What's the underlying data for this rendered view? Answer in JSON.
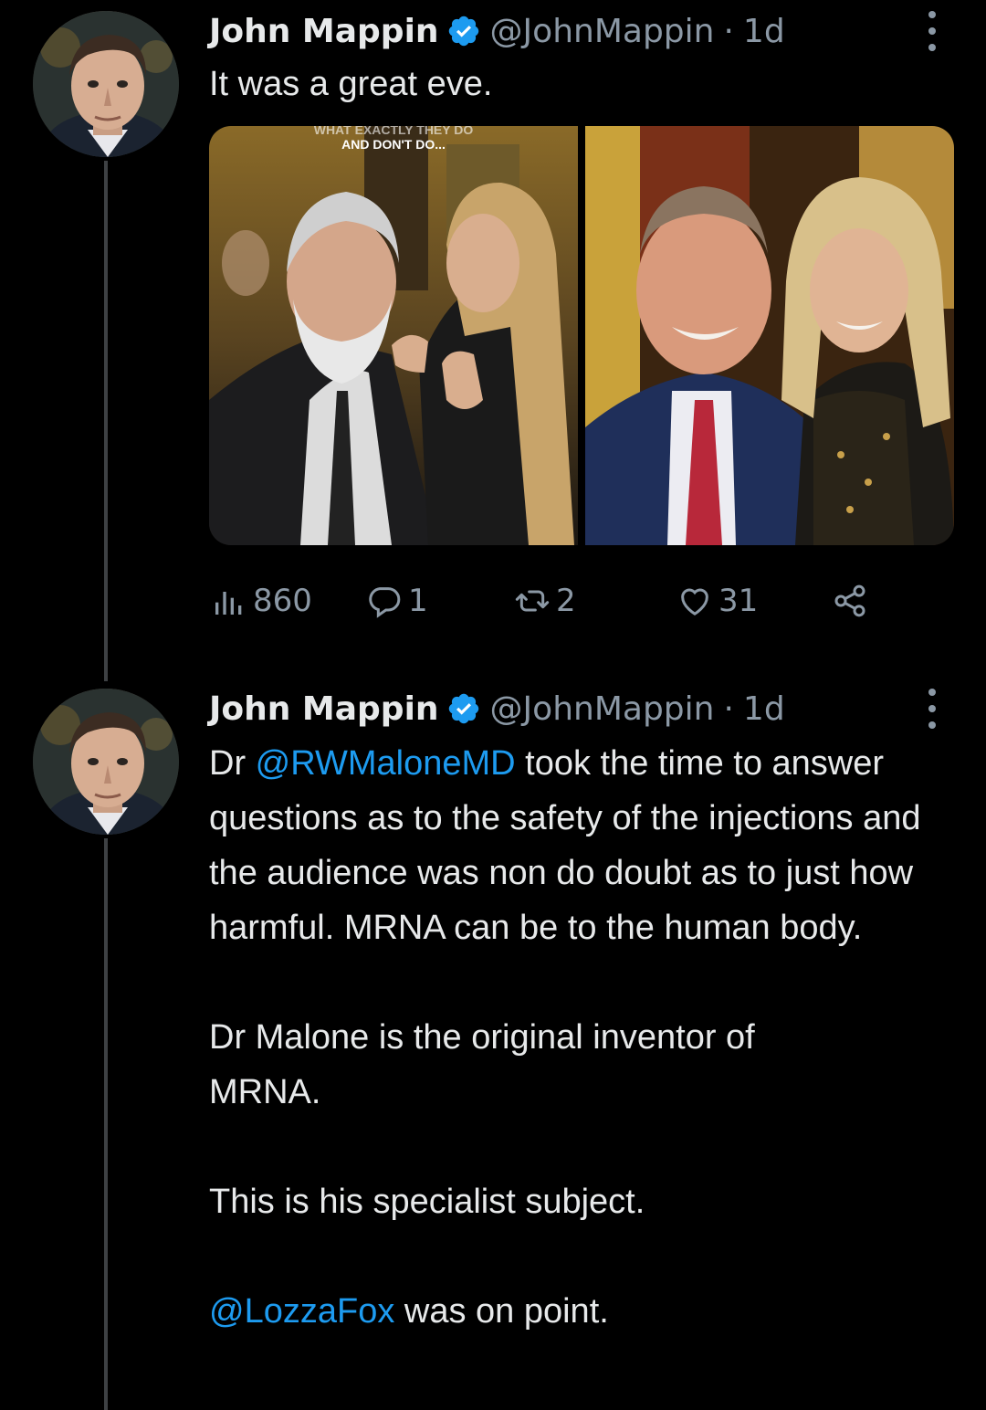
{
  "tweets": [
    {
      "author_name": "John Mappin",
      "handle": "@JohnMappin",
      "separator": "·",
      "time": "1d",
      "text": "It was a great eve.",
      "media": {
        "left_caption_top": "WHAT EXACTLY THEY DO",
        "left_caption": "AND DON'T DO..."
      },
      "stats": {
        "views": "860",
        "replies": "1",
        "retweets": "2",
        "likes": "31"
      }
    },
    {
      "author_name": "John Mappin",
      "handle": "@JohnMappin",
      "separator": "·",
      "time": "1d",
      "p1_prefix": "Dr ",
      "p1_mention": "@RWMaloneMD",
      "p1_rest": " took the time to answer questions as to the safety of the injections and the audience was non do doubt as to just how harmful. MRNA can be to the human body.",
      "p2": "Dr Malone is the original inventor of MRNA.",
      "p3": "This is his specialist subject.",
      "p4_mention": "@LozzaFox",
      "p4_rest": " was on point."
    }
  ],
  "colors": {
    "background": "#000000",
    "text": "#e7e9ea",
    "muted": "#8b98a5",
    "link": "#1d9bf0",
    "verified": "#1d9bf0",
    "thread_line": "#3e4144"
  },
  "icons": [
    "verified-badge-icon",
    "more-icon",
    "views-icon",
    "reply-icon",
    "retweet-icon",
    "like-icon",
    "share-icon"
  ]
}
